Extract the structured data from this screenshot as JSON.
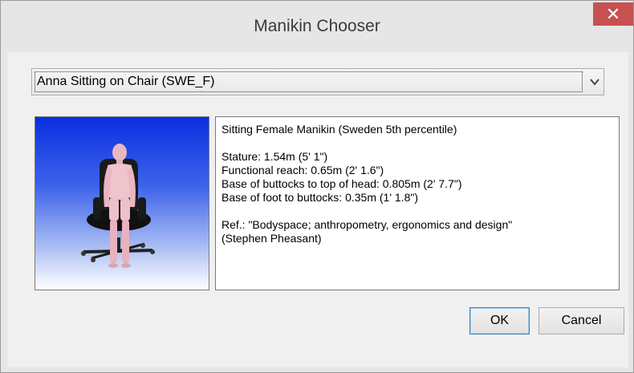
{
  "window": {
    "title": "Manikin Chooser",
    "close_label": "✕"
  },
  "manikin_select": {
    "value": "Anna Sitting on Chair (SWE_F)"
  },
  "preview": {
    "description": "Rendered female manikin seated on an office chair"
  },
  "description": {
    "heading": "Sitting Female Manikin (Sweden 5th percentile)",
    "measurements": [
      "Stature: 1.54m (5' 1\")",
      "Functional reach: 0.65m (2' 1.6\")",
      "Base of buttocks to top of head: 0.805m (2' 7.7\")",
      "Base of foot to buttocks: 0.35m (1' 1.8\")"
    ],
    "reference": [
      "Ref.: \"Bodyspace; anthropometry, ergonomics and design\"",
      "(Stephen Pheasant)"
    ]
  },
  "buttons": {
    "ok": "OK",
    "cancel": "Cancel"
  },
  "colors": {
    "close_button": "#c75050",
    "preview_top": "#0a2fe0",
    "preview_bottom": "#ffffff"
  }
}
